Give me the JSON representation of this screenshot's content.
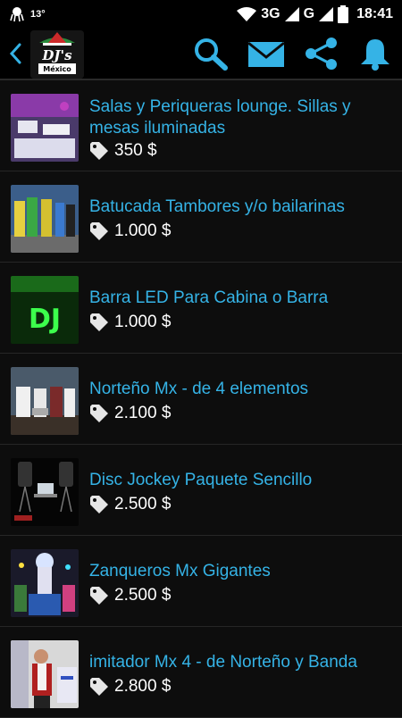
{
  "status_bar": {
    "temperature": "13°",
    "network": "3G",
    "carrier_signal": "G",
    "time": "18:41"
  },
  "action_bar": {
    "logo_text_top": "DJ's",
    "logo_text_bottom": "México"
  },
  "items": [
    {
      "title": "Salas y Periqueras lounge. Sillas y mesas iluminadas",
      "price": "350 $"
    },
    {
      "title": "Batucada  Tambores y/o bailarinas",
      "price": "1.000 $"
    },
    {
      "title": "Barra LED Para Cabina o Barra",
      "price": "1.000 $"
    },
    {
      "title": "Norteño Mx - de 4 elementos",
      "price": "2.100 $"
    },
    {
      "title": "Disc Jockey  Paquete Sencillo",
      "price": "2.500 $"
    },
    {
      "title": "Zanqueros Mx  Gigantes",
      "price": "2.500 $"
    },
    {
      "title": "imitador Mx 4 - de Norteño y Banda",
      "price": "2.800 $"
    }
  ],
  "colors": {
    "accent": "#35b3e6",
    "background": "#0d0d0d"
  }
}
